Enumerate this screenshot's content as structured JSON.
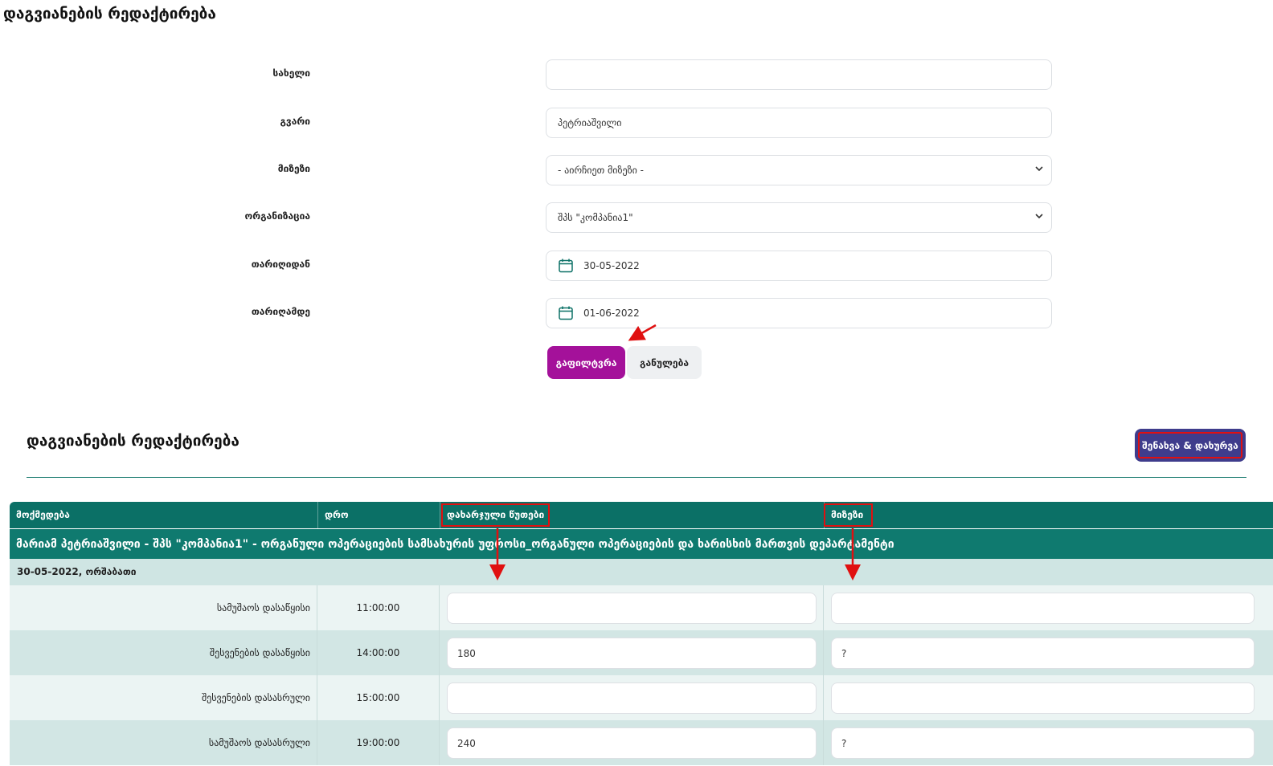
{
  "page": {
    "title": "დაგვიანების რედაქტირება"
  },
  "filter": {
    "first_name": {
      "label": "სახელი",
      "value": ""
    },
    "last_name": {
      "label": "გვარი",
      "value": "პეტრიაშვილი"
    },
    "reason": {
      "label": "მიზეზი",
      "selected": "- აირჩიეთ მიზეზი -"
    },
    "organization": {
      "label": "ორგანიზაცია",
      "selected": "შპს \"კომპანია1\""
    },
    "date_from": {
      "label": "თარიღიდან",
      "value": "30-05-2022"
    },
    "date_to": {
      "label": "თარიღამდე",
      "value": "01-06-2022"
    },
    "filter_button": "გაფილტვრა",
    "reset_button": "განულება"
  },
  "section": {
    "title": "დაგვიანების რედაქტირება",
    "save_button": "შენახვა & დახურვა"
  },
  "table": {
    "headers": [
      "მოქმედება",
      "დრო",
      "დახარჯული წუთები",
      "მიზეზი"
    ],
    "person": "მარიამ პეტრიაშვილი - შპს \"კომპანია1\" - ორგანული ოპერაციების სამსახურის უფროსი_ორგანული ოპერაციების და ხარისხის მართვის დეპარტამენტი",
    "date_group": "30-05-2022, ორშაბათი",
    "rows": [
      {
        "action": "სამუშაოს დასაწყისი",
        "time": "11:00:00",
        "minutes": "",
        "reason": ""
      },
      {
        "action": "შესვენების დასაწყისი",
        "time": "14:00:00",
        "minutes": "180",
        "reason": "?"
      },
      {
        "action": "შესვენების დასასრული",
        "time": "15:00:00",
        "minutes": "",
        "reason": ""
      },
      {
        "action": "სამუშაოს დასასრული",
        "time": "19:00:00",
        "minutes": "240",
        "reason": "?"
      }
    ]
  },
  "icons": {
    "calendar": "calendar-icon",
    "chevron": "chevron-down-icon",
    "annotation": "red-arrow-annotation"
  },
  "colors": {
    "primary": "#a4119a",
    "teal": "#0b7066",
    "save": "#3f3c8c",
    "highlight": "#e01010"
  }
}
